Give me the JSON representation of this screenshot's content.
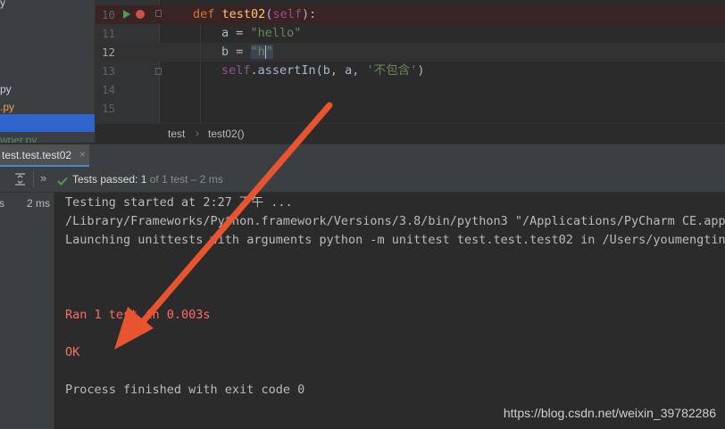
{
  "project": {
    "items": [
      {
        "label": "y",
        "color": "#c7cfe0"
      },
      {
        "label": "py",
        "color": "#c7cfe0"
      },
      {
        "label": ".py",
        "color": "#e8a04e"
      },
      {
        "label": "wper.py",
        "color": "#5f8a5f"
      }
    ]
  },
  "editor": {
    "lines": [
      {
        "no": "10"
      },
      {
        "no": "11"
      },
      {
        "no": "12"
      },
      {
        "no": "13"
      },
      {
        "no": "14"
      },
      {
        "no": "15"
      }
    ],
    "code": {
      "def_kw": "def",
      "func_name": "test02",
      "self_kw": "self",
      "paren_open": "(",
      "paren_close_colon": "):",
      "var_a": "a",
      "eq": " = ",
      "str_hello": "\"hello\"",
      "var_b": "b",
      "str_h_open": "\"h",
      "str_h_close": "\"",
      "assert_self": "self",
      "assert_call": ".assertIn(b, a, ",
      "assert_msg": "'不包含'",
      "assert_end": ")"
    }
  },
  "breadcrumb": {
    "items": [
      "test",
      "test02()"
    ],
    "separator": "›"
  },
  "run": {
    "tab_label": "test.test.test02",
    "tab_close": "×",
    "status_label": "Tests passed:",
    "status_count": "1",
    "status_detail": "of 1 test – 2 ms",
    "more_glyph": "»",
    "tree_item": "s",
    "tree_time": "2 ms"
  },
  "console": {
    "lines": [
      {
        "text": "Testing started at 2:27 下午 ...",
        "style": "normal"
      },
      {
        "text": "/Library/Frameworks/Python.framework/Versions/3.8/bin/python3 \"/Applications/PyCharm CE.app/C",
        "style": "normal"
      },
      {
        "text": "Launching unittests with arguments python -m unittest test.test.test02 in /Users/youmengting/",
        "style": "normal"
      },
      {
        "text": "",
        "style": "normal"
      },
      {
        "text": "",
        "style": "normal"
      },
      {
        "text": "",
        "style": "normal"
      },
      {
        "text": "Ran 1 test in 0.003s",
        "style": "red"
      },
      {
        "text": "",
        "style": "normal"
      },
      {
        "text": "OK",
        "style": "red"
      },
      {
        "text": "",
        "style": "normal"
      },
      {
        "text": "Process finished with exit code 0",
        "style": "normal"
      }
    ]
  },
  "watermark": "https://blog.csdn.net/weixin_39782286",
  "colors": {
    "accent_selection": "#2f65ca",
    "pass_green": "#499c54",
    "error_red": "#ff6b68",
    "arrow": "#e8542f"
  }
}
